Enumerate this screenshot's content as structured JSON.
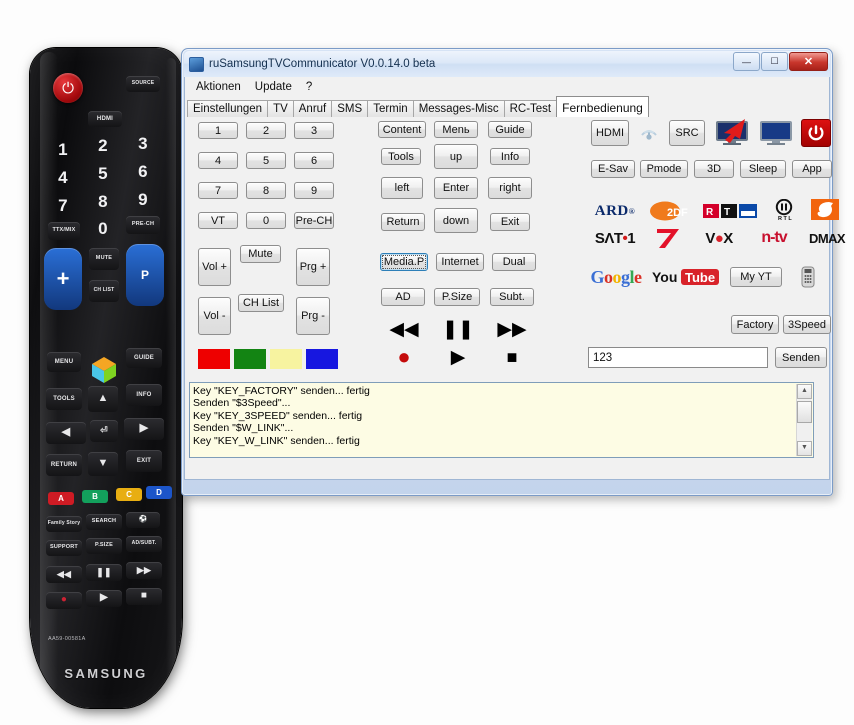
{
  "window": {
    "title": "ruSamsungTVCommunicator  V0.0.14.0 beta",
    "minimize": "—",
    "maximize": "❐",
    "close": "✕"
  },
  "menubar": {
    "items": [
      "Aktionen",
      "Update",
      "?"
    ]
  },
  "tabs": [
    {
      "label": "Einstellungen",
      "active": false
    },
    {
      "label": "TV",
      "active": false
    },
    {
      "label": "Anruf",
      "active": false
    },
    {
      "label": "SMS",
      "active": false
    },
    {
      "label": "Termin",
      "active": false
    },
    {
      "label": "Messages-Misc",
      "active": false
    },
    {
      "label": "RC-Test",
      "active": false
    },
    {
      "label": "Fernbedienung",
      "active": true
    }
  ],
  "numpad": {
    "keys": [
      "1",
      "2",
      "3",
      "4",
      "5",
      "6",
      "7",
      "8",
      "9",
      "VT",
      "0",
      "Pre-CH"
    ],
    "vol_up": "Vol +",
    "vol_down": "Vol -",
    "mute": "Mute",
    "ch_list": "CH List",
    "prg_up": "Prg +",
    "prg_down": "Prg -"
  },
  "colorkeys": [
    {
      "name": "red",
      "color": "#ee0000"
    },
    {
      "name": "green",
      "color": "#138413"
    },
    {
      "name": "yellow",
      "color": "#f7f3a0"
    },
    {
      "name": "blue",
      "color": "#1717e0"
    }
  ],
  "navpad": {
    "content": "Content",
    "menu": "Меnь",
    "guide": "Guide",
    "tools": "Tools",
    "up": "up",
    "info": "Info",
    "left": "left",
    "enter": "Enter",
    "right": "right",
    "return": "Return",
    "down": "down",
    "exit": "Exit",
    "media_p": "Media.P",
    "internet": "Internet",
    "dual": "Dual",
    "ad": "AD",
    "psize": "P.Size",
    "subt": "Subt."
  },
  "transport": {
    "rewind": "◀◀",
    "pause": "❚❚",
    "forward": "▶▶",
    "record": "●",
    "play": "▶",
    "stop": "■"
  },
  "sources": {
    "hdmi": "HDMI",
    "wifi_icon": "wifi-icon",
    "src": "SRC",
    "tv_red_icon": "tv-red-arrow-icon",
    "tv_blue_icon": "tv-blue-icon",
    "power_icon": "power-icon"
  },
  "modes": [
    "E-Sav",
    "Pmode",
    "3D",
    "Sleep",
    "App"
  ],
  "channel_logos_row1": [
    "ARD",
    "ZDF",
    "RTL",
    "RTL II",
    "SAT"
  ],
  "channel_logos_row2": [
    "SAT.1",
    "ProSieben",
    "VOX",
    "n-tv",
    "DMAX"
  ],
  "web": {
    "google": "Google",
    "youtube_you": "You",
    "youtube_tube": "Tube",
    "my_yt": "My YT",
    "remote_icon": "remote-icon"
  },
  "extra": {
    "factory": "Factory",
    "speed3": "3Speed"
  },
  "send": {
    "value": "123",
    "placeholder": "",
    "button": "Senden"
  },
  "log": {
    "lines": [
      "Key \"KEY_FACTORY\" senden... fertig",
      "Senden \"$3Speed\"...",
      "Key \"KEY_3SPEED\" senden... fertig",
      "Senden \"$W_LINK\"...",
      "Key \"KEY_W_LINK\" senden... fertig"
    ]
  },
  "remote_photo": {
    "brand": "SAMSUNG",
    "model_code": "AA59-00581A",
    "source": "SOURCE",
    "hdmi": "HDMI",
    "numbers": [
      "1",
      "2",
      "3",
      "4",
      "5",
      "6",
      "7",
      "8",
      "9"
    ],
    "ttx": "TTX/MIX",
    "zero": "0",
    "prech": "PRE-CH",
    "mute": "MUTE",
    "chlist": "CH LIST",
    "menu": "MENU",
    "guide": "GUIDE",
    "tools": "TOOLS",
    "info": "INFO",
    "return": "RETURN",
    "exit": "EXIT",
    "colorkeys": [
      "A",
      "B",
      "C",
      "D"
    ],
    "family_story": "Family Story",
    "search": "SEARCH",
    "support": "SUPPORT",
    "psize": "P.SIZE",
    "adsubt": "AD/SUBT."
  }
}
